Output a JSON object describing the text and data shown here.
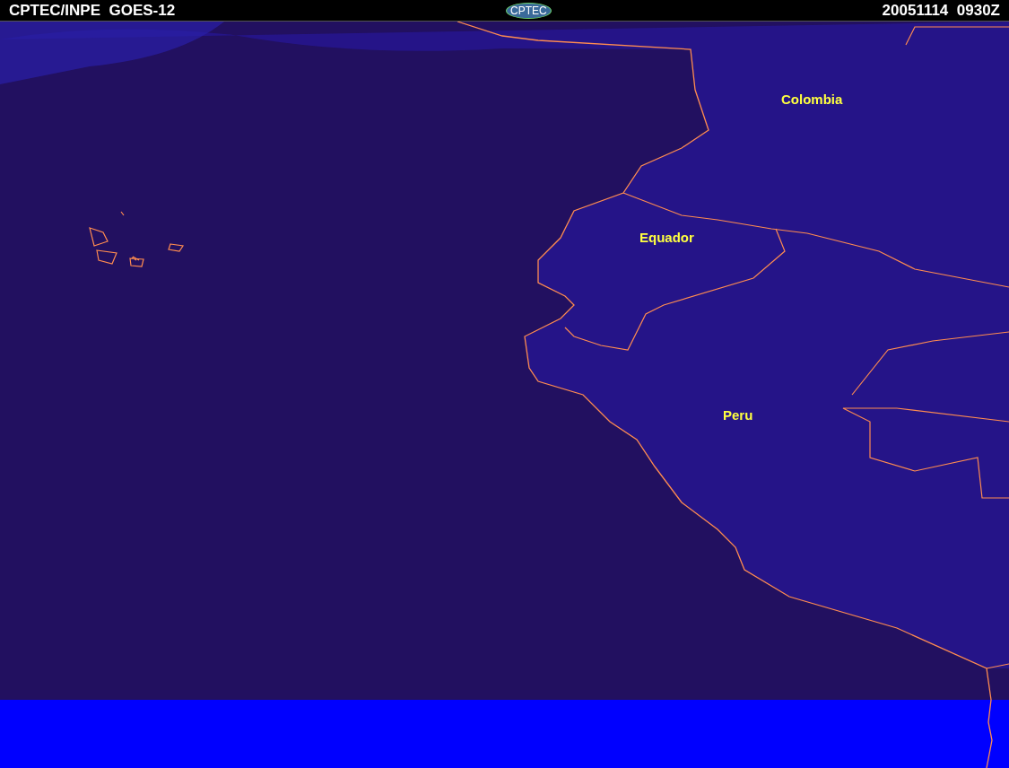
{
  "header": {
    "title": "CPTEC/INPE  GOES-12",
    "logo": "CPTEC",
    "timestamp": "20051114  0930Z"
  },
  "map": {
    "labels": [
      {
        "text": "Colombia"
      },
      {
        "text": "Equador"
      },
      {
        "text": "Peru"
      }
    ]
  }
}
